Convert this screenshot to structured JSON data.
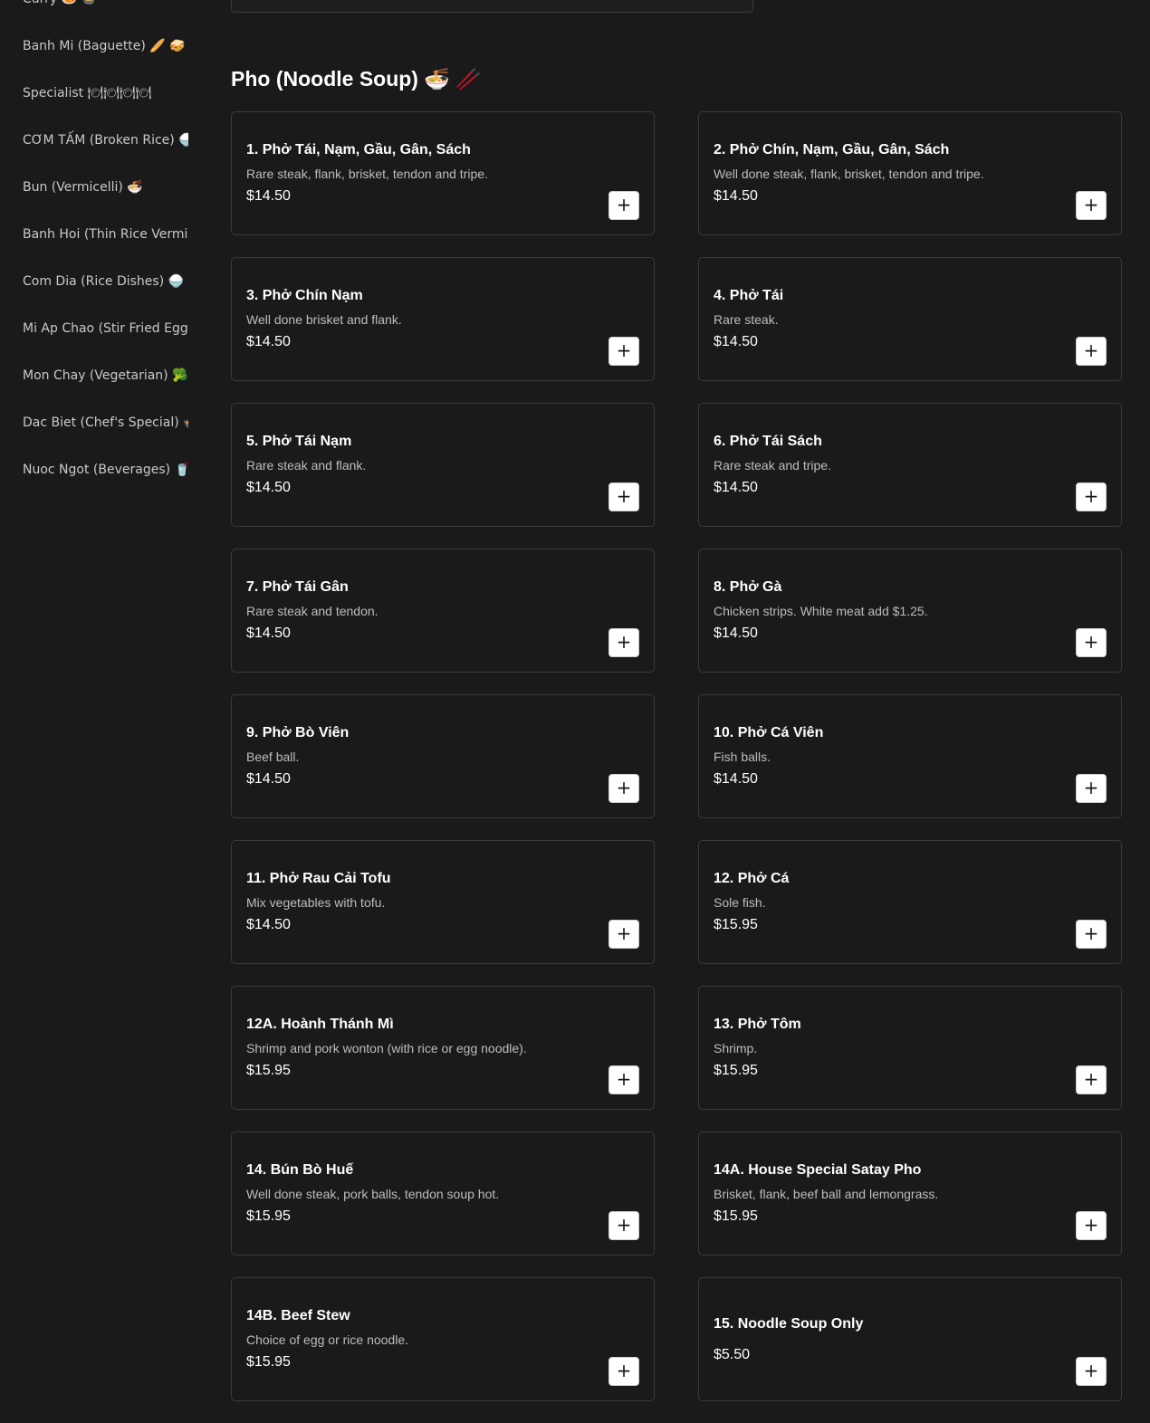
{
  "sidebar": {
    "items": [
      {
        "label": "Curry 🍛 🍲"
      },
      {
        "label": "Banh Mi (Baguette) 🥖 🥪"
      },
      {
        "label": "Specialist 🍽🍽🍽🍽"
      },
      {
        "label": "CƠM TẤM (Broken Rice) 🍚"
      },
      {
        "label": "Bun (Vermicelli) 🍜"
      },
      {
        "label": "Banh Hoi (Thin Rice Vermicelli)"
      },
      {
        "label": "Com Dia (Rice Dishes) 🍚 🍛"
      },
      {
        "label": "Mi Ap Chao (Stir Fried Egg Noodles)"
      },
      {
        "label": "Mon Chay (Vegetarian) 🥦 🥬"
      },
      {
        "label": "Dac Biet (Chef's Special) 🍲"
      },
      {
        "label": "Nuoc Ngot (Beverages) 🥤 🧋"
      }
    ]
  },
  "section": {
    "title": "Pho (Noodle Soup) 🍜 🥢"
  },
  "add_label": "+",
  "items": [
    {
      "name": "1. Phở Tái, Nạm, Gầu, Gân, Sách",
      "desc": "Rare steak, flank, brisket, tendon and tripe.",
      "price": "$14.50"
    },
    {
      "name": "2. Phở Chín, Nạm, Gầu, Gân, Sách",
      "desc": "Well done steak, flank, brisket, tendon and tripe.",
      "price": "$14.50"
    },
    {
      "name": "3. Phở Chín Nạm",
      "desc": "Well done brisket and flank.",
      "price": "$14.50"
    },
    {
      "name": "4. Phở Tái",
      "desc": "Rare steak.",
      "price": "$14.50"
    },
    {
      "name": "5. Phở Tái Nạm",
      "desc": "Rare steak and flank.",
      "price": "$14.50"
    },
    {
      "name": "6. Phở Tái Sách",
      "desc": "Rare steak and tripe.",
      "price": "$14.50"
    },
    {
      "name": "7. Phở Tái Gân",
      "desc": "Rare steak and tendon.",
      "price": "$14.50"
    },
    {
      "name": "8. Phở Gà",
      "desc": "Chicken strips. White meat add $1.25.",
      "price": "$14.50"
    },
    {
      "name": "9. Phở Bò Viên",
      "desc": "Beef ball.",
      "price": "$14.50"
    },
    {
      "name": "10. Phở Cá Viên",
      "desc": "Fish balls.",
      "price": "$14.50"
    },
    {
      "name": "11. Phở Rau Cải Tofu",
      "desc": "Mix vegetables with tofu.",
      "price": "$14.50"
    },
    {
      "name": "12. Phở Cá",
      "desc": "Sole fish.",
      "price": "$15.95"
    },
    {
      "name": "12A. Hoành Thánh Mì",
      "desc": "Shrimp and pork wonton (with rice or egg noodle).",
      "price": "$15.95"
    },
    {
      "name": "13. Phở Tôm",
      "desc": "Shrimp.",
      "price": "$15.95"
    },
    {
      "name": "14. Bún Bò Huế",
      "desc": "Well done steak, pork balls, tendon soup hot.",
      "price": "$15.95"
    },
    {
      "name": "14A. House Special Satay Pho",
      "desc": "Brisket, flank, beef ball and lemongrass.",
      "price": "$15.95"
    },
    {
      "name": "14B. Beef Stew",
      "desc": "Choice of egg or rice noodle.",
      "price": "$15.95"
    },
    {
      "name": "15. Noodle Soup Only",
      "desc": "",
      "price": "$5.50"
    }
  ]
}
